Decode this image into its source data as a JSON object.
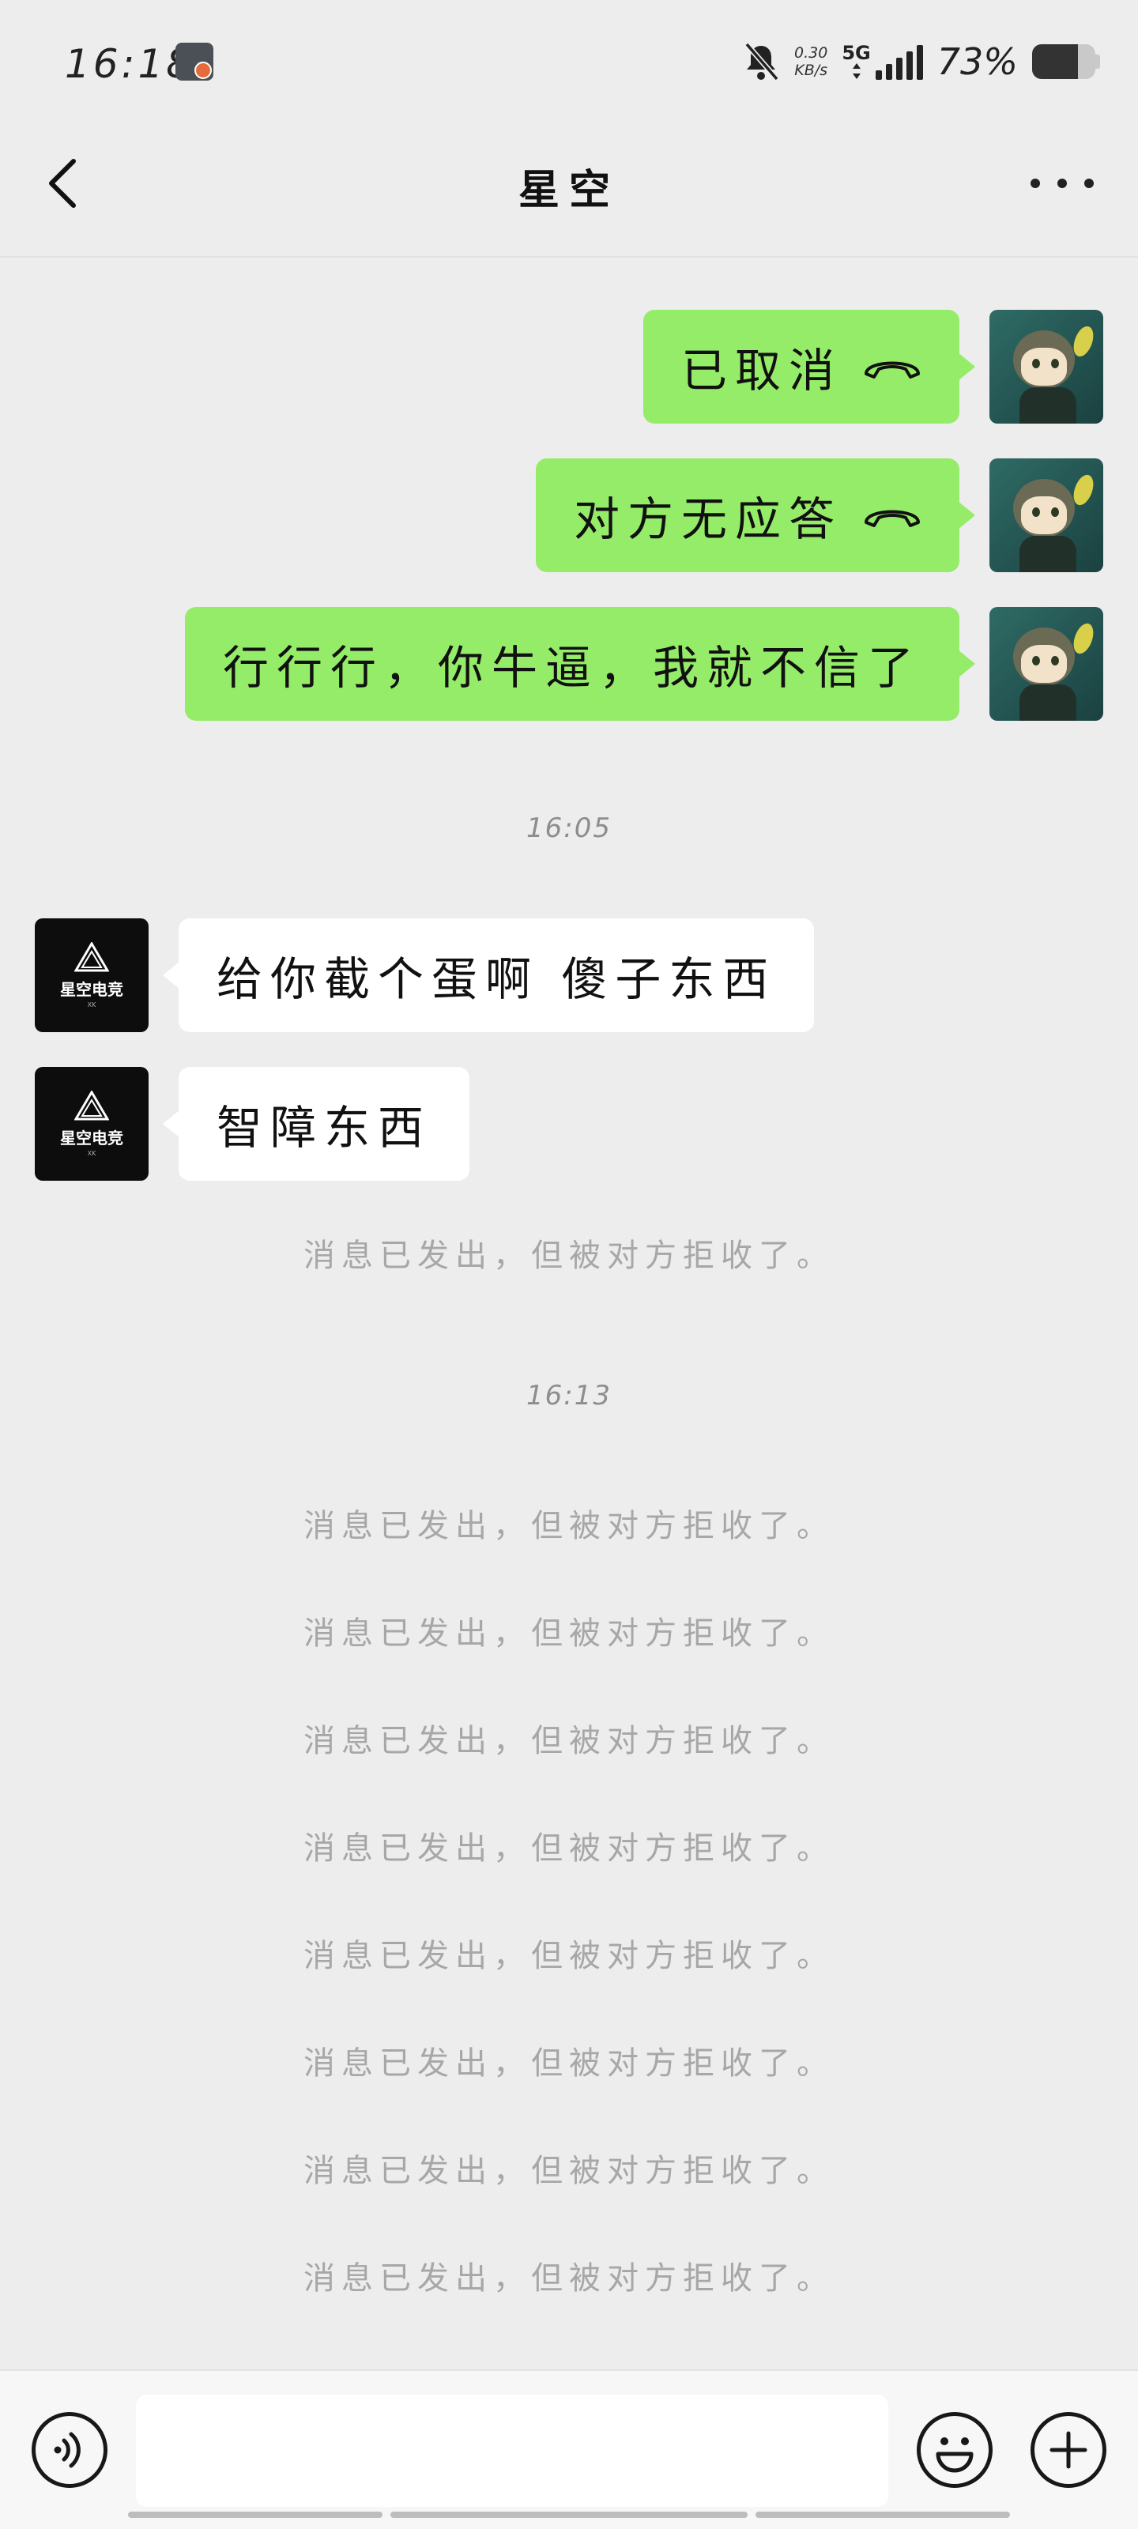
{
  "status_bar": {
    "time": "16:18",
    "net_speed_value": "0.30",
    "net_speed_unit": "KB/s",
    "network": "5G",
    "battery_pct": "73%",
    "battery_level": 0.73
  },
  "nav": {
    "title": "星空",
    "back_icon": "chevron-left-icon",
    "more_icon": "more-dots-icon"
  },
  "messages": [
    {
      "side": "right",
      "text": "已取消",
      "call_icon": true
    },
    {
      "side": "right",
      "text": "对方无应答",
      "call_icon": true
    },
    {
      "side": "right",
      "text": "行行行，你牛逼，我就不信了",
      "call_icon": false
    },
    {
      "type": "time",
      "text": "16:05"
    },
    {
      "side": "left",
      "text": "给你截个蛋啊 傻子东西"
    },
    {
      "side": "left",
      "text": "智障东西"
    },
    {
      "type": "system",
      "text": "消息已发出，但被对方拒收了。"
    },
    {
      "type": "time",
      "text": "16:13"
    },
    {
      "type": "system",
      "text": "消息已发出，但被对方拒收了。"
    },
    {
      "type": "system",
      "text": "消息已发出，但被对方拒收了。"
    },
    {
      "type": "system",
      "text": "消息已发出，但被对方拒收了。"
    },
    {
      "type": "system",
      "text": "消息已发出，但被对方拒收了。"
    },
    {
      "type": "system",
      "text": "消息已发出，但被对方拒收了。"
    },
    {
      "type": "system",
      "text": "消息已发出，但被对方拒收了。"
    },
    {
      "type": "system",
      "text": "消息已发出，但被对方拒收了。"
    },
    {
      "type": "system",
      "text": "消息已发出，但被对方拒收了。"
    }
  ],
  "contact_avatar": {
    "name": "星空电竞",
    "sub": "XK"
  },
  "input_bar": {
    "input_value": "",
    "voice_icon": "voice-icon",
    "emoji_icon": "emoji-icon",
    "plus_icon": "plus-icon"
  },
  "colors": {
    "sent_bubble": "#95EC69",
    "received_bubble": "#FFFFFF",
    "background": "#EDEDED",
    "system_text": "#A7A7A7"
  }
}
